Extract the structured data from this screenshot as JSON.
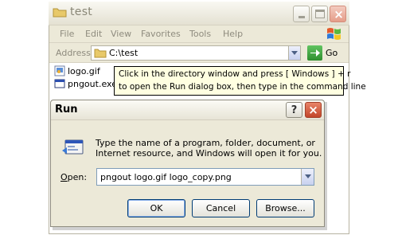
{
  "explorer": {
    "title": "test",
    "menu": [
      "File",
      "Edit",
      "View",
      "Favorites",
      "Tools",
      "Help"
    ],
    "address_label": "Address",
    "address_value": "C:\\test",
    "go_label": "Go",
    "files": [
      {
        "name": "logo.gif",
        "icon": "gif-image-icon"
      },
      {
        "name": "pngout.exe",
        "icon": "exe-application-icon"
      }
    ]
  },
  "tooltip": {
    "line1": "Click in the directory window and press  [ Windows ] + r",
    "line2": "to open the Run dialog box, then type in the command line"
  },
  "run_dialog": {
    "title": "Run",
    "help_label": "?",
    "close_label": "×",
    "description_line1": "Type the name of a program, folder, document, or",
    "description_line2": "Internet resource, and Windows will open it for you.",
    "open_label_prefix": "",
    "open_label_underlined": "O",
    "open_label_rest": "pen:",
    "open_value": "pngout  logo.gif  logo_copy.png",
    "ok_label": "OK",
    "cancel_label": "Cancel",
    "browse_label": "Browse..."
  },
  "colors": {
    "tooltip_bg": "#ffffe1",
    "dialog_bg": "#ece9d8",
    "close_red": "#c2452a",
    "go_green": "#2f8f2f"
  }
}
